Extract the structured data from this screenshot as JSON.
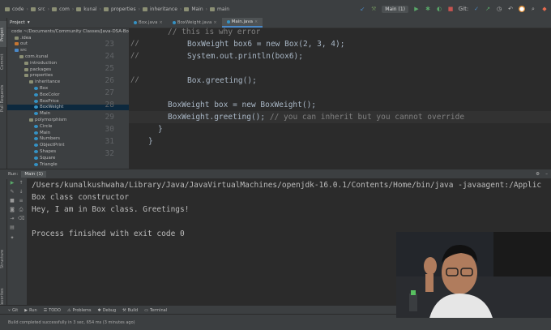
{
  "breadcrumb": [
    "code",
    "src",
    "com",
    "kunal",
    "properties",
    "inheritance",
    "Main",
    "main"
  ],
  "toolbar": {
    "run_config": "Main (1)",
    "run_icon": "play-icon",
    "debug_icon": "bug-icon"
  },
  "project_panel": {
    "title": "Project",
    "tree": [
      {
        "label": "code  ~/Documents/Community Classes/Java-DSA-Bootcamp",
        "depth": 0,
        "kind": "folder",
        "color": "#8b8f74"
      },
      {
        "label": ".idea",
        "depth": 1,
        "kind": "folder",
        "color": "#8b8f74"
      },
      {
        "label": "out",
        "depth": 1,
        "kind": "folder-excluded",
        "color": "#c57633"
      },
      {
        "label": "src",
        "depth": 1,
        "kind": "folder",
        "color": "#4a88c7"
      },
      {
        "label": "com.kunal",
        "depth": 2,
        "kind": "package",
        "color": "#8b8f74"
      },
      {
        "label": "introduction",
        "depth": 3,
        "kind": "package",
        "color": "#8b8f74"
      },
      {
        "label": "packages",
        "depth": 3,
        "kind": "package",
        "color": "#8b8f74"
      },
      {
        "label": "properties",
        "depth": 3,
        "kind": "package",
        "color": "#8b8f74"
      },
      {
        "label": "inheritance",
        "depth": 4,
        "kind": "package",
        "color": "#8b8f74"
      },
      {
        "label": "Box",
        "depth": 5,
        "kind": "class",
        "color": "#3592c4"
      },
      {
        "label": "BoxColor",
        "depth": 5,
        "kind": "class",
        "color": "#3592c4"
      },
      {
        "label": "BoxPrice",
        "depth": 5,
        "kind": "class",
        "color": "#3592c4"
      },
      {
        "label": "BoxWeight",
        "depth": 5,
        "kind": "class",
        "color": "#3592c4",
        "selected": true
      },
      {
        "label": "Main",
        "depth": 5,
        "kind": "class",
        "color": "#3592c4"
      },
      {
        "label": "polymorphism",
        "depth": 4,
        "kind": "package",
        "color": "#8b8f74"
      },
      {
        "label": "Circle",
        "depth": 5,
        "kind": "class",
        "color": "#3592c4"
      },
      {
        "label": "Main",
        "depth": 5,
        "kind": "class",
        "color": "#3592c4"
      },
      {
        "label": "Numbers",
        "depth": 5,
        "kind": "class",
        "color": "#3592c4"
      },
      {
        "label": "ObjectPrint",
        "depth": 5,
        "kind": "class",
        "color": "#3592c4"
      },
      {
        "label": "Shapes",
        "depth": 5,
        "kind": "class",
        "color": "#3592c4"
      },
      {
        "label": "Square",
        "depth": 5,
        "kind": "class",
        "color": "#3592c4"
      },
      {
        "label": "Triangle",
        "depth": 5,
        "kind": "class",
        "color": "#3592c4"
      }
    ]
  },
  "editor": {
    "tabs": [
      {
        "label": "Box.java",
        "active": false
      },
      {
        "label": "BoxWeight.java",
        "active": false
      },
      {
        "label": "Main.java",
        "active": true
      }
    ],
    "lines": [
      {
        "n": "",
        "text": "// this is why error",
        "indent": 1
      },
      {
        "n": "23",
        "text": "BoxWeight box6 = new Box(2, 3, 4);",
        "indent": 2,
        "mark": "//"
      },
      {
        "n": "24",
        "text": "System.out.println(box6);",
        "indent": 2,
        "mark": "//"
      },
      {
        "n": "25",
        "text": "",
        "indent": 0
      },
      {
        "n": "26",
        "text": "Box.greeting();",
        "indent": 2,
        "mark": "//"
      },
      {
        "n": "27",
        "text": "",
        "indent": 0
      },
      {
        "n": "28",
        "text": "BoxWeight box = new BoxWeight();",
        "indent": 1
      },
      {
        "n": "29",
        "text": "BoxWeight.greeting(); // you can inherit but you cannot override",
        "indent": 1
      },
      {
        "n": "30",
        "text": "}",
        "indent": 0.5
      },
      {
        "n": "31",
        "text": "}",
        "indent": 0
      },
      {
        "n": "32",
        "text": "",
        "indent": 0
      }
    ]
  },
  "run_panel": {
    "label": "Run:",
    "tab": "Main (1)",
    "console": [
      "/Users/kunalkushwaha/Library/Java/JavaVirtualMachines/openjdk-16.0.1/Contents/Home/bin/java -javaagent:/Applic",
      "Box class constructor",
      "Hey, I am in Box class. Greetings!",
      "",
      "Process finished with exit code 0"
    ]
  },
  "tool_windows": [
    "Git",
    "Run",
    "TODO",
    "Problems",
    "Debug",
    "Build",
    "Terminal"
  ],
  "status_text": "Build completed successfully in 3 sec, 654 ms (3 minutes ago)"
}
